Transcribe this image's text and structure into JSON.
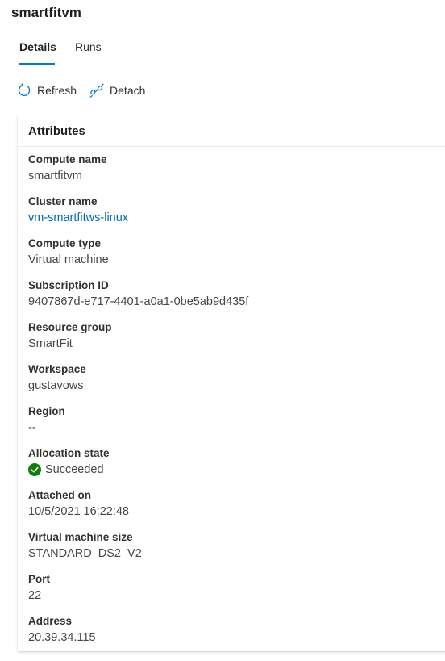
{
  "header": {
    "title": "smartfitvm"
  },
  "tabs": [
    {
      "label": "Details",
      "active": true
    },
    {
      "label": "Runs",
      "active": false
    }
  ],
  "toolbar": {
    "refresh_label": "Refresh",
    "detach_label": "Detach",
    "refresh_icon": "refresh-icon",
    "detach_icon": "detach-icon"
  },
  "attributes": {
    "title": "Attributes",
    "compute_name": {
      "label": "Compute name",
      "value": "smartfitvm"
    },
    "cluster_name": {
      "label": "Cluster name",
      "value": "vm-smartfitws-linux"
    },
    "compute_type": {
      "label": "Compute type",
      "value": "Virtual machine"
    },
    "subscription_id": {
      "label": "Subscription ID",
      "value": "9407867d-e717-4401-a0a1-0be5ab9d435f"
    },
    "resource_group": {
      "label": "Resource group",
      "value": "SmartFit"
    },
    "workspace": {
      "label": "Workspace",
      "value": "gustavows"
    },
    "region": {
      "label": "Region",
      "value": "--"
    },
    "allocation_state": {
      "label": "Allocation state",
      "value": "Succeeded",
      "icon": "success-check-icon"
    },
    "attached_on": {
      "label": "Attached on",
      "value": "10/5/2021 16:22:48"
    },
    "vm_size": {
      "label": "Virtual machine size",
      "value": "STANDARD_DS2_V2"
    },
    "port": {
      "label": "Port",
      "value": "22"
    },
    "address": {
      "label": "Address",
      "value": "20.39.34.115"
    }
  },
  "colors": {
    "accent": "#0078d4",
    "link": "#0067b8",
    "success": "#107c10",
    "text": "#323130"
  }
}
